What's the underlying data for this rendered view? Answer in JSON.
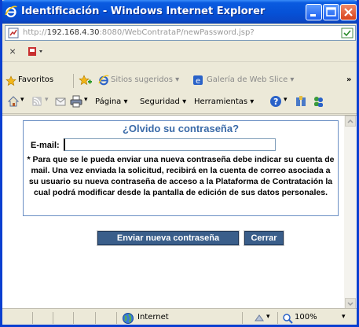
{
  "window": {
    "title": "Identificación - Windows Internet Explorer"
  },
  "address_bar": {
    "url_prefix": "http://",
    "url_host": "192.168.4.30",
    "url_rest": ":8080/WebContrataP/newPassword.jsp?"
  },
  "favorites_bar": {
    "favorites_label": "Favoritos",
    "suggested_sites_label": "Sitios sugeridos",
    "web_slice_gallery_label": "Galería de Web Slice"
  },
  "command_bar": {
    "page_label": "Página",
    "security_label": "Seguridad",
    "tools_label": "Herramientas"
  },
  "form": {
    "title": "¿Olvido su contraseña?",
    "email_label": "E-mail:",
    "email_value": "",
    "note": "* Para que se le pueda enviar una nueva contraseña debe indicar su cuenta de mail. Una vez enviada la solicitud, recibirá en la cuenta de correo asociada a su usuario su nueva contraseña de acceso a la Plataforma de Contratación la cual podrá modificar desde la pantalla de edición de sus datos personales.",
    "send_button": "Enviar nueva contraseña",
    "close_button": "Cerrar"
  },
  "status_bar": {
    "zone_label": "Internet",
    "zoom_label": "100%"
  },
  "colors": {
    "titlebar": "#0651d6",
    "form_title": "#3a6aa8",
    "button_bg": "#3a5e8a"
  }
}
